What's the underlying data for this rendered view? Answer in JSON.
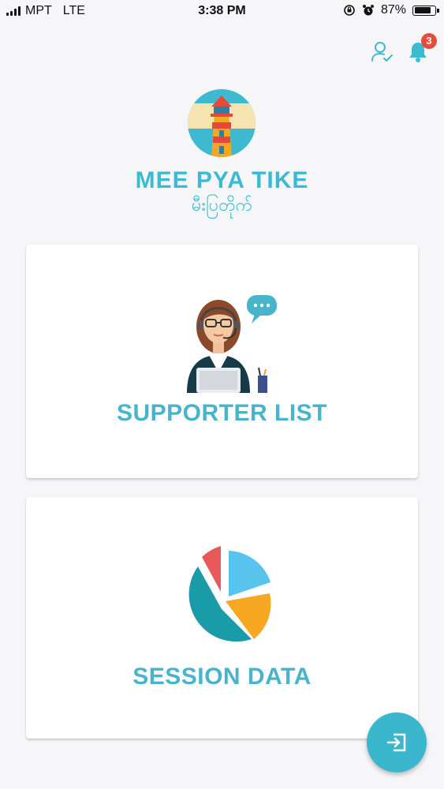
{
  "status_bar": {
    "carrier": "MPT",
    "network": "LTE",
    "time": "3:38 PM",
    "battery_percent": "87%",
    "battery_level": 0.87
  },
  "header": {
    "notification_count": "3"
  },
  "brand": {
    "name": "MEE PYA TIKE",
    "subtitle": "မီးပြတိုက်"
  },
  "cards": [
    {
      "label": "SUPPORTER LIST",
      "icon": "supporter-illustration-icon"
    },
    {
      "label": "SESSION DATA",
      "icon": "pie-chart-icon"
    }
  ],
  "fab": {
    "icon": "logout-icon"
  },
  "colors": {
    "accent": "#3cbad2",
    "badge": "#e84b3c",
    "background": "#f6f6f8"
  }
}
